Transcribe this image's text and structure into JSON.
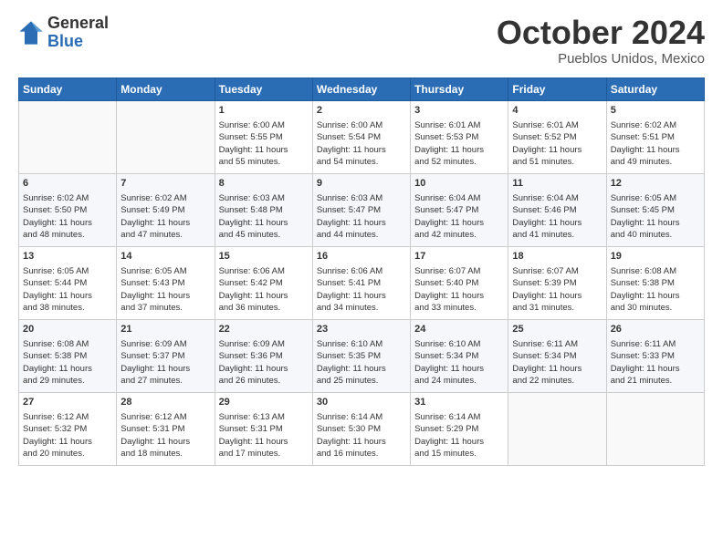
{
  "header": {
    "logo_general": "General",
    "logo_blue": "Blue",
    "month": "October 2024",
    "location": "Pueblos Unidos, Mexico"
  },
  "days_of_week": [
    "Sunday",
    "Monday",
    "Tuesday",
    "Wednesday",
    "Thursday",
    "Friday",
    "Saturday"
  ],
  "weeks": [
    [
      {
        "day": "",
        "info": ""
      },
      {
        "day": "",
        "info": ""
      },
      {
        "day": "1",
        "info": "Sunrise: 6:00 AM\nSunset: 5:55 PM\nDaylight: 11 hours\nand 55 minutes."
      },
      {
        "day": "2",
        "info": "Sunrise: 6:00 AM\nSunset: 5:54 PM\nDaylight: 11 hours\nand 54 minutes."
      },
      {
        "day": "3",
        "info": "Sunrise: 6:01 AM\nSunset: 5:53 PM\nDaylight: 11 hours\nand 52 minutes."
      },
      {
        "day": "4",
        "info": "Sunrise: 6:01 AM\nSunset: 5:52 PM\nDaylight: 11 hours\nand 51 minutes."
      },
      {
        "day": "5",
        "info": "Sunrise: 6:02 AM\nSunset: 5:51 PM\nDaylight: 11 hours\nand 49 minutes."
      }
    ],
    [
      {
        "day": "6",
        "info": "Sunrise: 6:02 AM\nSunset: 5:50 PM\nDaylight: 11 hours\nand 48 minutes."
      },
      {
        "day": "7",
        "info": "Sunrise: 6:02 AM\nSunset: 5:49 PM\nDaylight: 11 hours\nand 47 minutes."
      },
      {
        "day": "8",
        "info": "Sunrise: 6:03 AM\nSunset: 5:48 PM\nDaylight: 11 hours\nand 45 minutes."
      },
      {
        "day": "9",
        "info": "Sunrise: 6:03 AM\nSunset: 5:47 PM\nDaylight: 11 hours\nand 44 minutes."
      },
      {
        "day": "10",
        "info": "Sunrise: 6:04 AM\nSunset: 5:47 PM\nDaylight: 11 hours\nand 42 minutes."
      },
      {
        "day": "11",
        "info": "Sunrise: 6:04 AM\nSunset: 5:46 PM\nDaylight: 11 hours\nand 41 minutes."
      },
      {
        "day": "12",
        "info": "Sunrise: 6:05 AM\nSunset: 5:45 PM\nDaylight: 11 hours\nand 40 minutes."
      }
    ],
    [
      {
        "day": "13",
        "info": "Sunrise: 6:05 AM\nSunset: 5:44 PM\nDaylight: 11 hours\nand 38 minutes."
      },
      {
        "day": "14",
        "info": "Sunrise: 6:05 AM\nSunset: 5:43 PM\nDaylight: 11 hours\nand 37 minutes."
      },
      {
        "day": "15",
        "info": "Sunrise: 6:06 AM\nSunset: 5:42 PM\nDaylight: 11 hours\nand 36 minutes."
      },
      {
        "day": "16",
        "info": "Sunrise: 6:06 AM\nSunset: 5:41 PM\nDaylight: 11 hours\nand 34 minutes."
      },
      {
        "day": "17",
        "info": "Sunrise: 6:07 AM\nSunset: 5:40 PM\nDaylight: 11 hours\nand 33 minutes."
      },
      {
        "day": "18",
        "info": "Sunrise: 6:07 AM\nSunset: 5:39 PM\nDaylight: 11 hours\nand 31 minutes."
      },
      {
        "day": "19",
        "info": "Sunrise: 6:08 AM\nSunset: 5:38 PM\nDaylight: 11 hours\nand 30 minutes."
      }
    ],
    [
      {
        "day": "20",
        "info": "Sunrise: 6:08 AM\nSunset: 5:38 PM\nDaylight: 11 hours\nand 29 minutes."
      },
      {
        "day": "21",
        "info": "Sunrise: 6:09 AM\nSunset: 5:37 PM\nDaylight: 11 hours\nand 27 minutes."
      },
      {
        "day": "22",
        "info": "Sunrise: 6:09 AM\nSunset: 5:36 PM\nDaylight: 11 hours\nand 26 minutes."
      },
      {
        "day": "23",
        "info": "Sunrise: 6:10 AM\nSunset: 5:35 PM\nDaylight: 11 hours\nand 25 minutes."
      },
      {
        "day": "24",
        "info": "Sunrise: 6:10 AM\nSunset: 5:34 PM\nDaylight: 11 hours\nand 24 minutes."
      },
      {
        "day": "25",
        "info": "Sunrise: 6:11 AM\nSunset: 5:34 PM\nDaylight: 11 hours\nand 22 minutes."
      },
      {
        "day": "26",
        "info": "Sunrise: 6:11 AM\nSunset: 5:33 PM\nDaylight: 11 hours\nand 21 minutes."
      }
    ],
    [
      {
        "day": "27",
        "info": "Sunrise: 6:12 AM\nSunset: 5:32 PM\nDaylight: 11 hours\nand 20 minutes."
      },
      {
        "day": "28",
        "info": "Sunrise: 6:12 AM\nSunset: 5:31 PM\nDaylight: 11 hours\nand 18 minutes."
      },
      {
        "day": "29",
        "info": "Sunrise: 6:13 AM\nSunset: 5:31 PM\nDaylight: 11 hours\nand 17 minutes."
      },
      {
        "day": "30",
        "info": "Sunrise: 6:14 AM\nSunset: 5:30 PM\nDaylight: 11 hours\nand 16 minutes."
      },
      {
        "day": "31",
        "info": "Sunrise: 6:14 AM\nSunset: 5:29 PM\nDaylight: 11 hours\nand 15 minutes."
      },
      {
        "day": "",
        "info": ""
      },
      {
        "day": "",
        "info": ""
      }
    ]
  ]
}
